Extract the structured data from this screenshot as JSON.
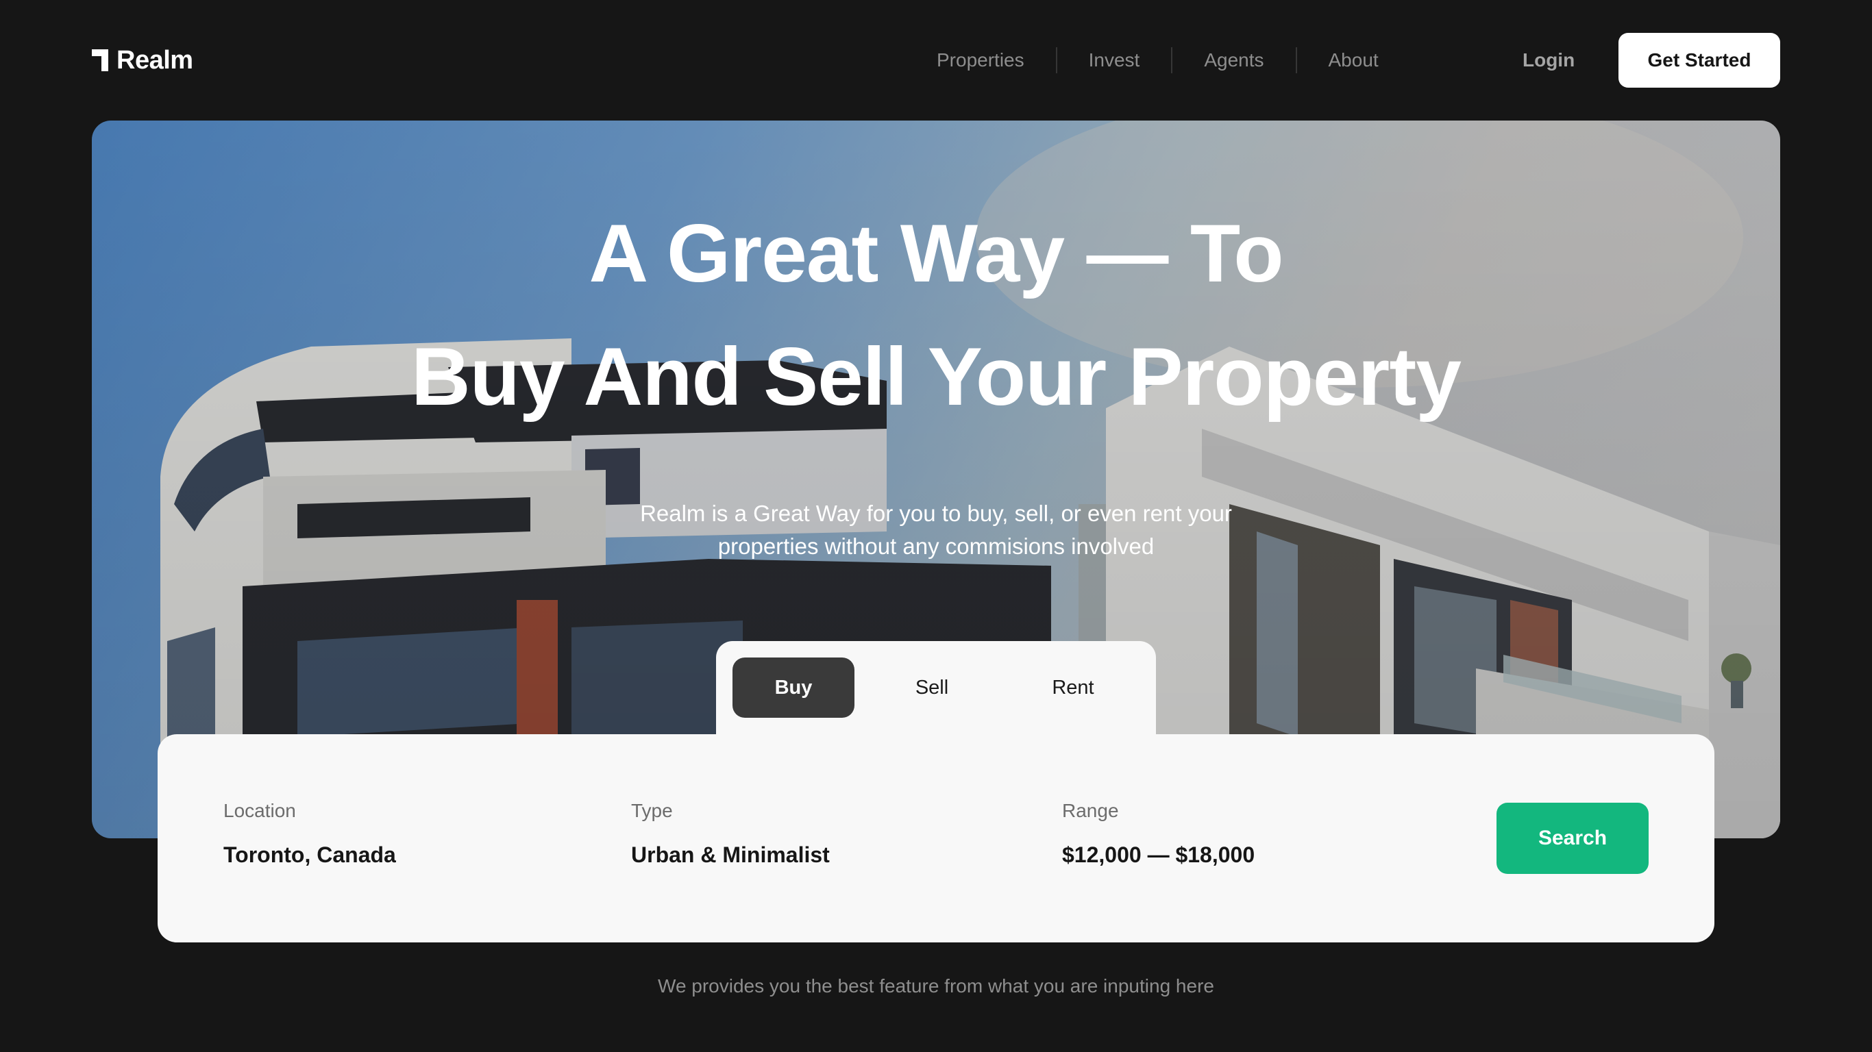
{
  "brand": {
    "name": "Realm",
    "icon": "realm-logo-icon"
  },
  "nav": {
    "links": [
      "Properties",
      "Invest",
      "Agents",
      "About"
    ],
    "login_label": "Login",
    "cta_label": "Get Started"
  },
  "hero": {
    "title_line1": "A Great Way — To",
    "title_line2": "Buy And Sell Your Property",
    "subtitle_line1": "Realm is a Great Way for you to buy, sell, or even rent your",
    "subtitle_line2": "properties without any commisions involved"
  },
  "tabs": {
    "items": [
      "Buy",
      "Sell",
      "Rent"
    ],
    "active": "Buy"
  },
  "search": {
    "location_label": "Location",
    "location_value": "Toronto, Canada",
    "type_label": "Type",
    "type_value": "Urban & Minimalist",
    "range_label": "Range",
    "range_value": "$12,000 — $18,000",
    "button_label": "Search"
  },
  "footnote": "We provides you the best feature from what you are inputing here",
  "colors": {
    "background": "#161616",
    "accent_green": "#13b77e",
    "card": "#f8f8f8",
    "active_tab": "#3a3a3a"
  }
}
